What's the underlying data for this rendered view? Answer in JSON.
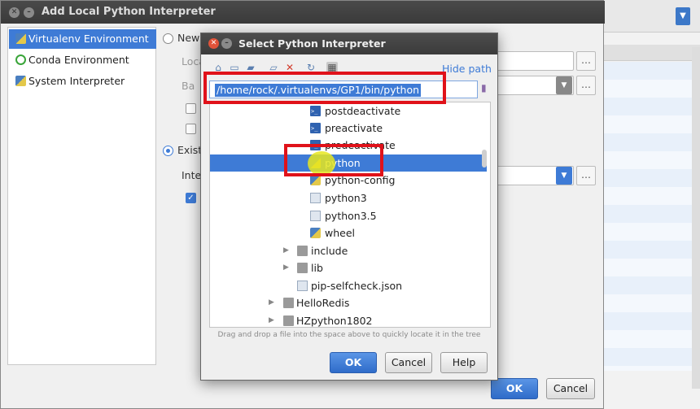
{
  "back_dialog": {
    "title": "Add Local Python Interpreter",
    "env_types": [
      {
        "label": "Virtualenv Environment",
        "selected": true
      },
      {
        "label": "Conda Environment",
        "selected": false
      },
      {
        "label": "System Interpreter",
        "selected": false
      }
    ],
    "radio_new": "New",
    "label_location": "Loca",
    "label_base": "Ba",
    "radio_existing": "Exist",
    "label_interpreter": "Inte",
    "ok": "OK",
    "cancel": "Cancel"
  },
  "front_dialog": {
    "title": "Select Python Interpreter",
    "hide_path": "Hide path",
    "path": "/home/rock/.virtualenvs/GP1/bin/python",
    "tree": [
      {
        "label": "postdeactivate",
        "icon": "script-icon"
      },
      {
        "label": "preactivate",
        "icon": "script-icon"
      },
      {
        "label": "predeactivate",
        "icon": "script-icon"
      },
      {
        "label": "python",
        "icon": "python-file-icon",
        "selected": true
      },
      {
        "label": "python-config",
        "icon": "python-file-icon"
      },
      {
        "label": "python3",
        "icon": "file-icon"
      },
      {
        "label": "python3.5",
        "icon": "file-icon"
      },
      {
        "label": "wheel",
        "icon": "python-file-icon"
      },
      {
        "label": "include",
        "icon": "folder-icon"
      },
      {
        "label": "lib",
        "icon": "folder-icon"
      },
      {
        "label": "pip-selfcheck.json",
        "icon": "file-icon"
      },
      {
        "label": "HelloRedis",
        "icon": "folder-icon"
      },
      {
        "label": "HZpython1802",
        "icon": "folder-icon"
      }
    ],
    "hint": "Drag and drop a file into the space above to quickly locate it in the tree",
    "ok": "OK",
    "cancel": "Cancel",
    "help": "Help"
  },
  "colors": {
    "accent": "#3e7bd6",
    "annotation_red": "#e0121a",
    "highlight_yellow": "#e6e61e"
  }
}
